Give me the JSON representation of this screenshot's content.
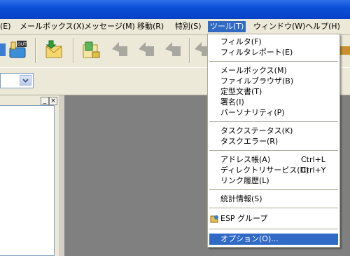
{
  "menubar": {
    "items": [
      "(E)",
      "メールボックス(X)",
      "メッセージ(M)",
      "移動(R)",
      "特別(S)",
      "ツール(T)",
      "ウィンドウ(W)",
      "ヘルプ(H)"
    ]
  },
  "toolbar": {
    "icons": [
      "mailbox-icon",
      "mail-out-icon",
      "check-mail-icon",
      "new-message-icon",
      "reply-icon",
      "reply-all-icon",
      "forward-icon",
      "redirect-icon"
    ]
  },
  "tools_menu": {
    "items": [
      {
        "label": "フィルタ(F)"
      },
      {
        "label": "フィルタレポート(E)"
      },
      {
        "label": "メールボックス(M)"
      },
      {
        "label": "ファイルブラウザ(B)"
      },
      {
        "label": "定型文書(T)"
      },
      {
        "label": "署名(I)"
      },
      {
        "label": "パーソナリティ(P)"
      },
      {
        "label": "タスクステータス(K)"
      },
      {
        "label": "タスクエラー(R)"
      },
      {
        "label": "アドレス帳(A)",
        "shortcut": "Ctrl+L"
      },
      {
        "label": "ディレクトリサービス(D)",
        "shortcut": "Ctrl+Y"
      },
      {
        "label": "リンク履歴(L)"
      },
      {
        "label": "統計情報(S)"
      },
      {
        "label": "ESP グループ"
      },
      {
        "label": "オプション(O)..."
      }
    ]
  },
  "left_pane": {
    "buttons": [
      "_",
      "×"
    ]
  }
}
